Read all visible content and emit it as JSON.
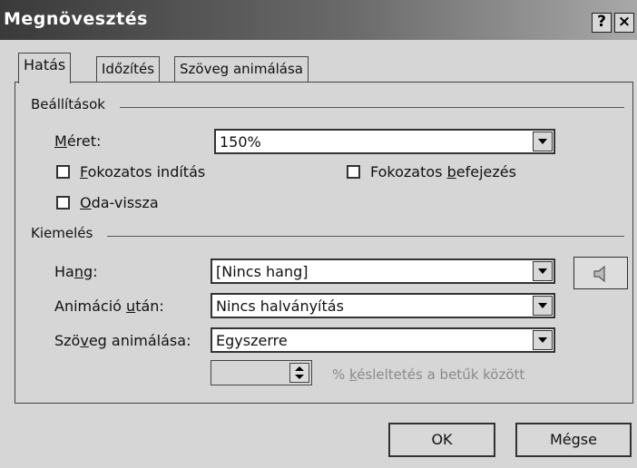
{
  "window": {
    "title": "Megnövesztés",
    "help_button": "?",
    "close_button": "×"
  },
  "tabs": [
    {
      "label": "Hatás",
      "active": true
    },
    {
      "label": "Időzítés",
      "active": false
    },
    {
      "label": "Szöveg animálása",
      "active": false
    }
  ],
  "settings": {
    "group_label": "Beállítások",
    "size_label_u": "M",
    "size_label_rest": "éret:",
    "size_value": "150%",
    "smooth_start_u": "F",
    "smooth_start_rest": "okozatos indítás",
    "smooth_start_checked": false,
    "smooth_end_pre": "Fokozatos ",
    "smooth_end_u": "b",
    "smooth_end_rest": "efejezés",
    "smooth_end_checked": false,
    "autoreverse_u": "O",
    "autoreverse_rest": "da-vissza",
    "autoreverse_checked": false
  },
  "enhancements": {
    "group_label": "Kiemelés",
    "sound_label_pre": "Ha",
    "sound_label_u": "n",
    "sound_label_rest": "g:",
    "sound_value": "[Nincs hang]",
    "after_anim_label_pre": "Animáció ",
    "after_anim_label_u": "u",
    "after_anim_label_rest": "tán:",
    "after_anim_value": "Nincs halványítás",
    "animate_text_label_pre": "Szö",
    "animate_text_label_u": "v",
    "animate_text_label_rest": "eg animálása:",
    "animate_text_value": "Egyszerre",
    "delay_value": "",
    "delay_label_pre": "% ",
    "delay_label_u": "k",
    "delay_label_rest": "ésleltetés a betűk között"
  },
  "buttons": {
    "ok": "OK",
    "cancel": "Mégse"
  },
  "icons": {
    "sound": "speaker-icon",
    "dropdown": "chevron-down-icon",
    "spinner": "spinner-arrows-icon"
  }
}
